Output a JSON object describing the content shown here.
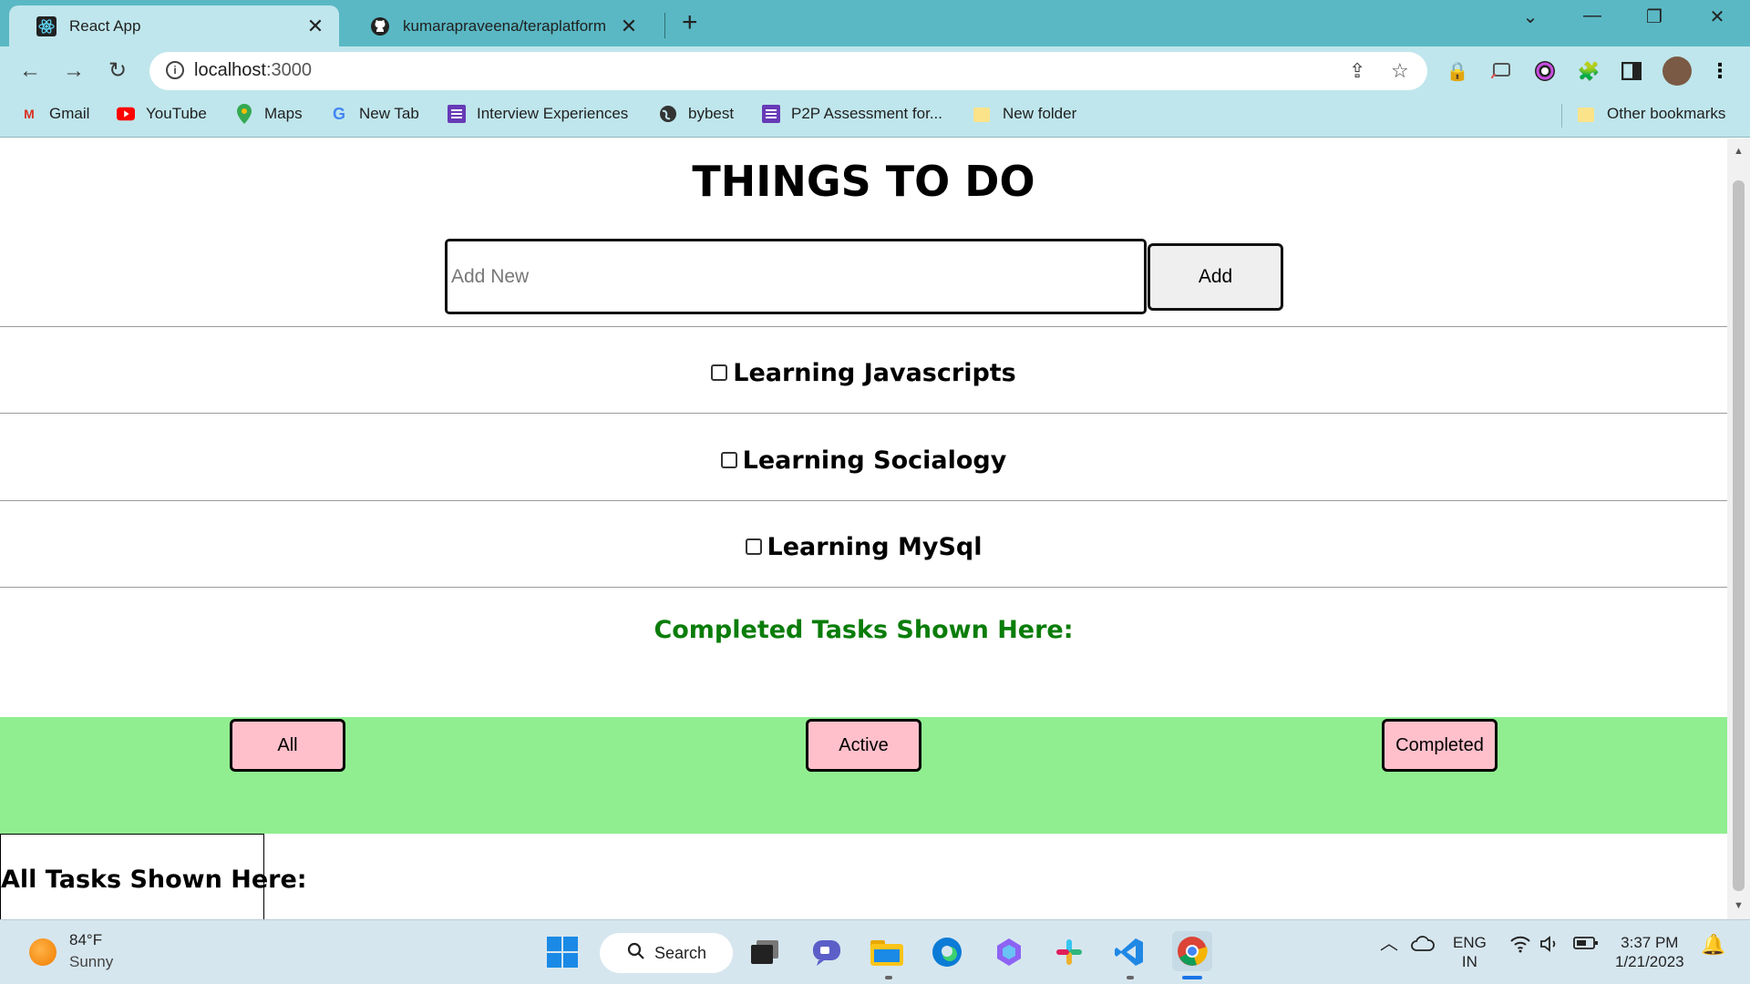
{
  "browser": {
    "tabs": [
      {
        "title": "React App",
        "active": true
      },
      {
        "title": "kumarapraveena/teraplatform",
        "active": false
      }
    ],
    "url_host": "localhost",
    "url_port": ":3000",
    "bookmarks": [
      "Gmail",
      "YouTube",
      "Maps",
      "New Tab",
      "Interview Experiences",
      "bybest",
      "P2P Assessment for...",
      "New folder"
    ],
    "other_bookmarks": "Other bookmarks"
  },
  "app": {
    "heading": "THINGS TO DO",
    "input_placeholder": "Add New",
    "add_label": "Add",
    "todos": [
      {
        "text": "Learning Javascripts",
        "done": false
      },
      {
        "text": "Learning Socialogy",
        "done": false
      },
      {
        "text": "Learning MySql",
        "done": false
      }
    ],
    "completed_heading": "Completed Tasks Shown Here:",
    "filters": [
      "All",
      "Active",
      "Completed"
    ],
    "all_tasks_heading": "All Tasks Shown Here:",
    "colors": {
      "filter_bar": "#90ee90",
      "filter_button": "#ffc0cb",
      "completed_heading": "#0a7d0a"
    }
  },
  "taskbar": {
    "weather_temp": "84°F",
    "weather_condition": "Sunny",
    "search_label": "Search",
    "lang_top": "ENG",
    "lang_bottom": "IN",
    "time": "3:37 PM",
    "date": "1/21/2023"
  }
}
